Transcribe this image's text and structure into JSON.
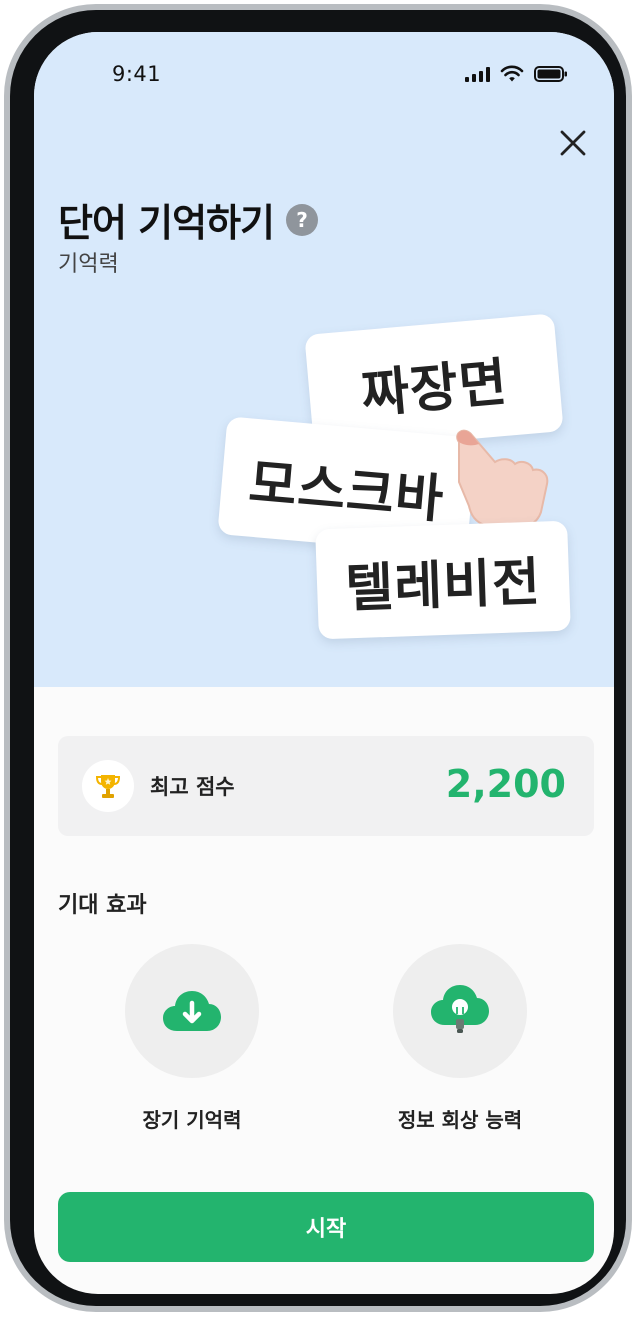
{
  "status_bar": {
    "time": "9:41"
  },
  "header": {
    "title": "단어 기억하기",
    "help_icon": "question-mark",
    "subtitle": "기억력",
    "close_icon": "close-x"
  },
  "illustration": {
    "cards": [
      "짜장면",
      "모스크바",
      "텔레비전"
    ]
  },
  "best_score": {
    "label": "최고 점수",
    "value": "2,200",
    "icon": "trophy"
  },
  "expected_effects": {
    "title": "기대 효과",
    "items": [
      {
        "label": "장기 기억력",
        "icon": "cloud-download"
      },
      {
        "label": "정보 회상 능력",
        "icon": "cloud-lightbulb"
      }
    ]
  },
  "start_button": {
    "label": "시작"
  },
  "colors": {
    "accent": "#23b46e",
    "hero_bg": "#d8e9fb",
    "score_card_bg": "#f1f1f2"
  }
}
